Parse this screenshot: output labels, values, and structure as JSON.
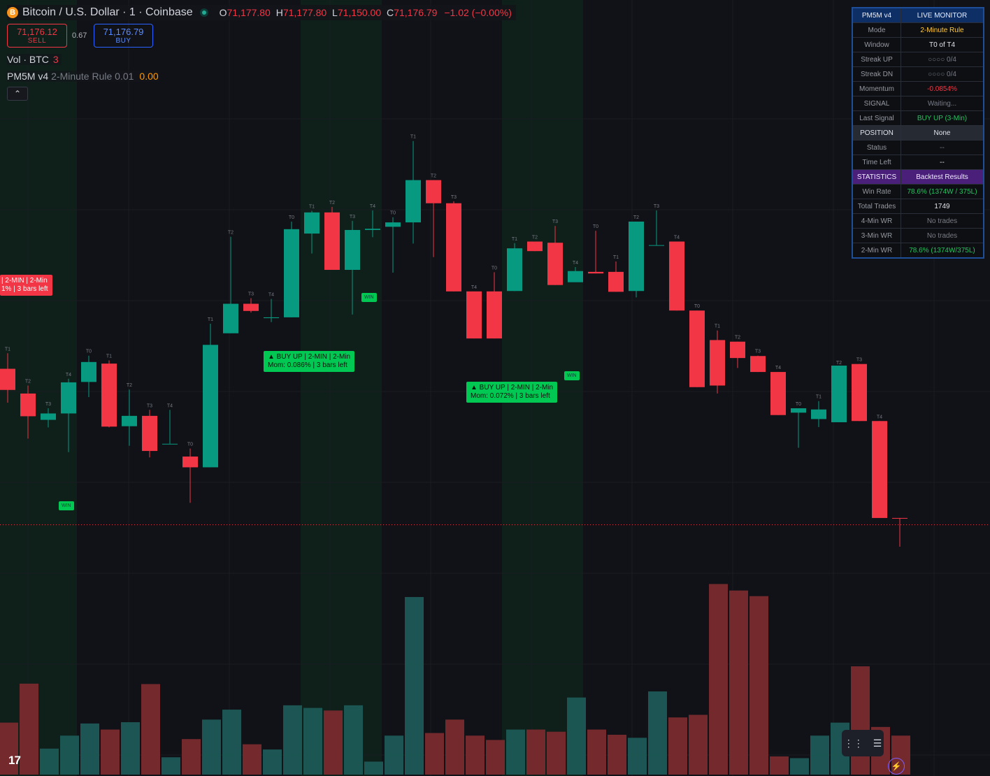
{
  "header": {
    "coin_icon": "B",
    "symbol": "Bitcoin / U.S. Dollar · 1 · Coinbase",
    "status_icon": "market-open-dot-icon",
    "ohlc": {
      "o_label": "O",
      "o": "71,177.80",
      "h_label": "H",
      "h": "71,177.80",
      "l_label": "L",
      "l": "71,150.00",
      "c_label": "C",
      "c": "71,176.79",
      "chg": "−1.02 (−0.00%)"
    }
  },
  "trade": {
    "sell_price": "71,176.12",
    "sell_label": "SELL",
    "spread": "0.67",
    "buy_price": "71,176.79",
    "buy_label": "BUY"
  },
  "volume_legend": {
    "label": "Vol · BTC",
    "value": "3"
  },
  "indicator": {
    "name": "PM5M v4",
    "params": "2-Minute Rule 0.01",
    "value": "0.00"
  },
  "collapse_icon": "chevron-up-icon",
  "monitor": {
    "title": "PM5M v4",
    "title_value": "LIVE MONITOR",
    "rows": [
      {
        "label": "Mode",
        "value": "2-Minute Rule"
      },
      {
        "label": "Window",
        "value": "T0 of T4"
      },
      {
        "label": "Streak UP",
        "value": "○○○○  0/4"
      },
      {
        "label": "Streak DN",
        "value": "○○○○  0/4"
      },
      {
        "label": "Momentum",
        "value": "-0.0854%"
      },
      {
        "label": "SIGNAL",
        "value": "Waiting..."
      },
      {
        "label": "Last Signal",
        "value": "BUY UP  (3-Min)"
      },
      {
        "label": "POSITION",
        "value": "None"
      },
      {
        "label": "Status",
        "value": "--"
      },
      {
        "label": "Time Left",
        "value": "--"
      },
      {
        "label": "STATISTICS",
        "value": "Backtest Results"
      },
      {
        "label": "Win Rate",
        "value": "78.6%  (1374W / 375L)"
      },
      {
        "label": "Total Trades",
        "value": "1749"
      },
      {
        "label": "4-Min WR",
        "value": "No trades"
      },
      {
        "label": "3-Min WR",
        "value": "No trades"
      },
      {
        "label": "2-Min WR",
        "value": "78.6%  (1374W/375L)"
      }
    ],
    "colors": {
      "header": "#0d2f66",
      "stats": "#4a1f7a",
      "up": "#22c55e",
      "down": "#f23645",
      "mode": "#ffca3a"
    }
  },
  "signals": [
    {
      "line1": "▲ BUY UP | 2-MIN | 2-Min",
      "line2": "Mom: 0.086% | 3 bars left"
    },
    {
      "line1": "▲ BUY UP | 2-MIN | 2-Min",
      "line2": "Mom: 0.072% | 3 bars left"
    },
    {
      "line1": "| 2-MIN | 2-Min",
      "line2": "1% | 3 bars left"
    }
  ],
  "win_label": "WIN",
  "tv_logo": "17",
  "tool_icons": [
    "drag-handle-icon",
    "indicator-settings-icon"
  ],
  "bolt_icon": "⚡",
  "chart_data": {
    "type": "candlestick",
    "colors": {
      "up": "#089981",
      "down": "#f23645",
      "signal_up": "#00c853"
    },
    "candles": [
      {
        "l": "T1",
        "o": 71194.6,
        "h": 71198.5,
        "l_": 71186.1,
        "c": 71189.3
      },
      {
        "l": "T2",
        "o": 71188.4,
        "h": 71190.4,
        "l_": 71177.1,
        "c": 71182.7
      },
      {
        "l": "T3",
        "o": 71181.8,
        "h": 71184.7,
        "l_": 71179.9,
        "c": 71183.4
      },
      {
        "l": "T4",
        "o": 71183.4,
        "h": 71192.1,
        "l_": 71173.7,
        "c": 71191.2
      },
      {
        "l": "T0",
        "o": 71191.3,
        "h": 71197.9,
        "l_": 71187.5,
        "c": 71196.3
      },
      {
        "l": "T1",
        "o": 71195.9,
        "h": 71196.7,
        "l_": 71179.9,
        "c": 71180.1
      },
      {
        "l": "T2",
        "o": 71180.2,
        "h": 71189.4,
        "l_": 71175.3,
        "c": 71182.8
      },
      {
        "l": "T3",
        "o": 71182.8,
        "h": 71184.3,
        "l_": 71172.4,
        "c": 71174.0
      },
      {
        "l": "T4",
        "o": 71175.8,
        "h": 71184.3,
        "l_": 71175.8,
        "c": 71175.8
      },
      {
        "l": "T0",
        "o": 71172.6,
        "h": 71174.6,
        "l_": 71161.0,
        "c": 71169.9
      },
      {
        "l": "T1",
        "o": 71169.9,
        "h": 71205.9,
        "l_": 71169.9,
        "c": 71200.6
      },
      {
        "l": "T2",
        "o": 71203.5,
        "h": 71227.7,
        "l_": 71203.5,
        "c": 71210.9
      },
      {
        "l": "T3",
        "o": 71210.9,
        "h": 71212.3,
        "l_": 71208.7,
        "c": 71209.1
      },
      {
        "l": "T4",
        "o": 71207.3,
        "h": 71212.1,
        "l_": 71206.3,
        "c": 71207.5
      },
      {
        "l": "T0",
        "o": 71207.5,
        "h": 71231.5,
        "l_": 71207.5,
        "c": 71229.6
      },
      {
        "l": "T1",
        "o": 71228.5,
        "h": 71234.2,
        "l_": 71223.5,
        "c": 71233.8
      },
      {
        "l": "T2",
        "o": 71233.8,
        "h": 71235.2,
        "l_": 71219.4,
        "c": 71219.4
      },
      {
        "l": "T3",
        "o": 71219.4,
        "h": 71231.7,
        "l_": 71208.2,
        "c": 71229.4
      },
      {
        "l": "T4",
        "o": 71229.4,
        "h": 71234.3,
        "l_": 71227.6,
        "c": 71229.7
      },
      {
        "l": "T0",
        "o": 71230.2,
        "h": 71232.6,
        "l_": 71218.7,
        "c": 71231.3
      },
      {
        "l": "T1",
        "o": 71231.3,
        "h": 71251.7,
        "l_": 71226.0,
        "c": 71241.9
      },
      {
        "l": "T2",
        "o": 71241.9,
        "h": 71241.9,
        "l_": 71222.6,
        "c": 71236.1
      },
      {
        "l": "T3",
        "o": 71236.1,
        "h": 71236.6,
        "l_": 71214.0,
        "c": 71214.0
      },
      {
        "l": "T4",
        "o": 71214.0,
        "h": 71214.0,
        "l_": 71202.2,
        "c": 71202.2
      },
      {
        "l": "T0",
        "o": 71214.0,
        "h": 71218.8,
        "l_": 71202.2,
        "c": 71202.2
      },
      {
        "l": "T1",
        "o": 71214.1,
        "h": 71226.1,
        "l_": 71214.1,
        "c": 71224.8
      },
      {
        "l": "T2",
        "o": 71226.5,
        "h": 71226.5,
        "l_": 71224.1,
        "c": 71224.1
      },
      {
        "l": "T3",
        "o": 71226.2,
        "h": 71230.4,
        "l_": 71215.6,
        "c": 71215.6
      },
      {
        "l": "T4",
        "o": 71216.3,
        "h": 71220.1,
        "l_": 71218.7,
        "c": 71219.1
      },
      {
        "l": "T0",
        "o": 71218.9,
        "h": 71229.2,
        "l_": 71218.5,
        "c": 71218.5
      },
      {
        "l": "T1",
        "o": 71218.9,
        "h": 71221.5,
        "l_": 71213.9,
        "c": 71213.9
      },
      {
        "l": "T2",
        "o": 71214.1,
        "h": 71231.5,
        "l_": 71212.5,
        "c": 71231.5
      },
      {
        "l": "T3",
        "o": 71225.6,
        "h": 71234.3,
        "l_": 71225.6,
        "c": 71225.6
      },
      {
        "l": "T4",
        "o": 71226.5,
        "h": 71226.5,
        "l_": 71209.2,
        "c": 71209.2
      },
      {
        "l": "T0",
        "o": 71209.2,
        "h": 71209.2,
        "l_": 71190.0,
        "c": 71190.0
      },
      {
        "l": "T1",
        "o": 71201.8,
        "h": 71204.2,
        "l_": 71188.4,
        "c": 71190.4
      },
      {
        "l": "T2",
        "o": 71201.4,
        "h": 71201.4,
        "l_": 71194.8,
        "c": 71197.3
      },
      {
        "l": "T3",
        "o": 71197.8,
        "h": 71197.9,
        "l_": 71193.8,
        "c": 71193.8
      },
      {
        "l": "T4",
        "o": 71193.8,
        "h": 71193.8,
        "l_": 71183.0,
        "c": 71183.0
      },
      {
        "l": "T0",
        "o": 71183.6,
        "h": 71184.7,
        "l_": 71174.8,
        "c": 71184.7
      },
      {
        "l": "T1",
        "o": 71182.0,
        "h": 71186.5,
        "l_": 71180.0,
        "c": 71184.4
      },
      {
        "l": "T2",
        "o": 71181.2,
        "h": 71195.0,
        "l_": 71181.2,
        "c": 71195.4
      },
      {
        "l": "T3",
        "o": 71195.8,
        "h": 71195.8,
        "l_": 71181.5,
        "c": 71181.5
      },
      {
        "l": "T4",
        "o": 71181.5,
        "h": 71181.5,
        "l_": 71157.2,
        "c": 71157.2
      },
      {
        "l": "",
        "o": 71157.2,
        "h": 71157.2,
        "l_": 71150.0,
        "c": 71157.1
      }
    ],
    "volumes": [
      120,
      210,
      60,
      90,
      118,
      104,
      121,
      209,
      40,
      82,
      127,
      150,
      70,
      58,
      160,
      154,
      148,
      160,
      30,
      90,
      410,
      96,
      127,
      90,
      80,
      104,
      104,
      99,
      178,
      104,
      92,
      85,
      192,
      132,
      138,
      440,
      425,
      412,
      42,
      38,
      90,
      120,
      250,
      110,
      90
    ],
    "current_price": "71,176.79",
    "current_price_value": 71155.5
  }
}
